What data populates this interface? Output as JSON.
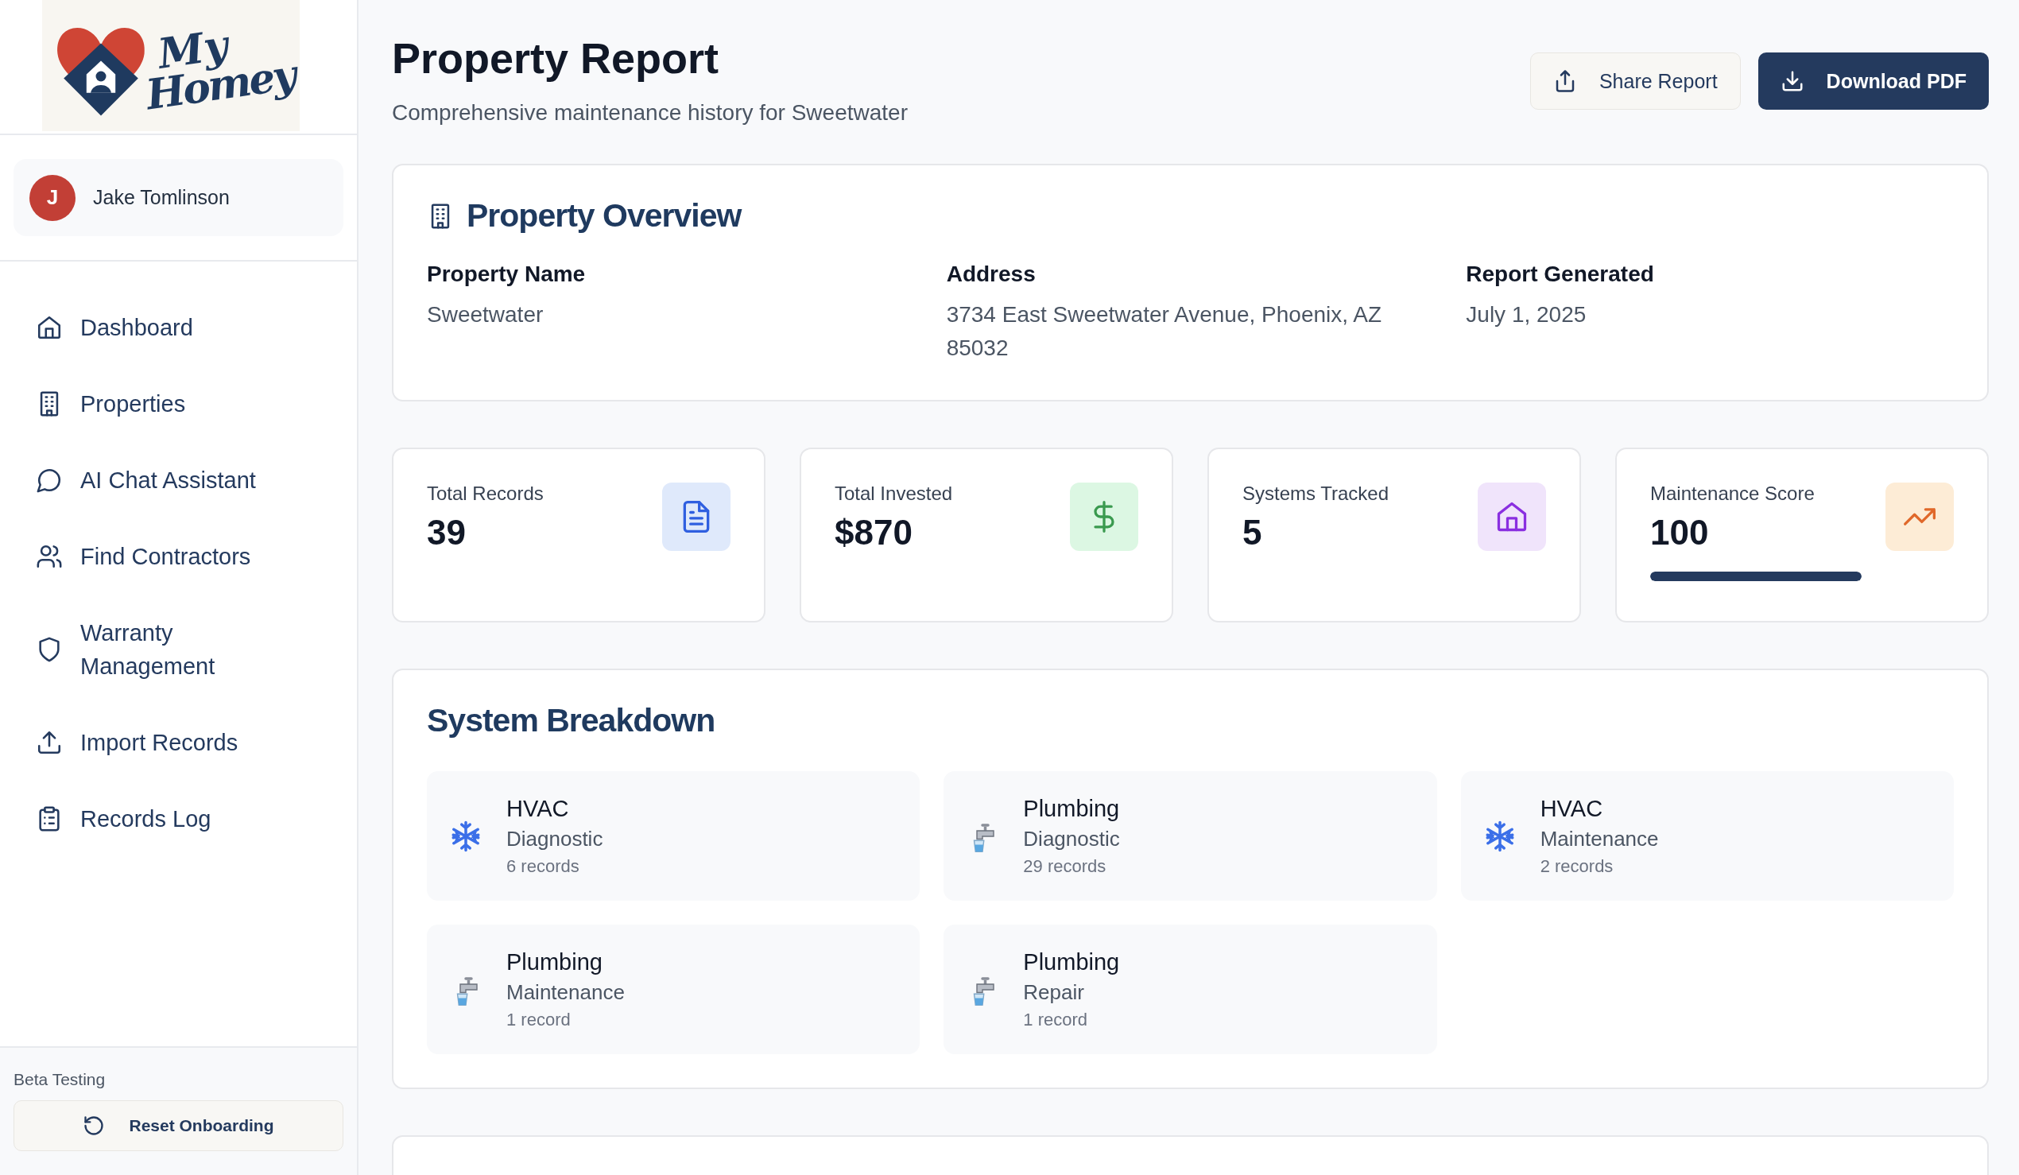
{
  "logo": {
    "line_1": "My",
    "line_2": "Homey"
  },
  "user": {
    "initial": "J",
    "name": "Jake Tomlinson"
  },
  "nav": [
    {
      "kind": "home",
      "label": "Dashboard",
      "selected": false
    },
    {
      "kind": "building",
      "label": "Properties",
      "selected": false
    },
    {
      "kind": "chat",
      "label": "AI Chat Assistant",
      "selected": false
    },
    {
      "kind": "users",
      "label": "Find Contractors",
      "selected": false
    },
    {
      "kind": "shield",
      "label": "Warranty Management",
      "selected": false
    },
    {
      "kind": "upload",
      "label": "Import Records",
      "selected": false
    },
    {
      "kind": "clipboard",
      "label": "Records Log",
      "selected": false
    }
  ],
  "beta": {
    "label": "Beta Testing",
    "button": "Reset Onboarding"
  },
  "header": {
    "title": "Property Report",
    "subtitle": "Comprehensive maintenance history for Sweetwater",
    "share_button": "Share Report",
    "download_button": "Download PDF"
  },
  "overview": {
    "title": "Property Overview",
    "fields": [
      {
        "label": "Property Name",
        "value": "Sweetwater"
      },
      {
        "label": "Address",
        "value": "3734 East Sweetwater Avenue, Phoenix, AZ 85032"
      },
      {
        "label": "Report Generated",
        "value": "July 1, 2025"
      }
    ]
  },
  "stats": [
    {
      "kind": "document",
      "label": "Total Records",
      "value": "39"
    },
    {
      "kind": "dollar",
      "label": "Total Invested",
      "value": "$870"
    },
    {
      "kind": "house",
      "label": "Systems Tracked",
      "value": "5"
    },
    {
      "kind": "trend",
      "label": "Maintenance Score",
      "value": "100",
      "level": 1.0
    }
  ],
  "breakdown": {
    "title": "System Breakdown",
    "items": [
      {
        "kind": "hvac",
        "system": "HVAC",
        "type": "Diagnostic",
        "count": "6 records"
      },
      {
        "kind": "plumbing",
        "system": "Plumbing",
        "type": "Diagnostic",
        "count": "29 records"
      },
      {
        "kind": "hvac",
        "system": "HVAC",
        "type": "Maintenance",
        "count": "2 records"
      },
      {
        "kind": "plumbing",
        "system": "Plumbing",
        "type": "Maintenance",
        "count": "1 record"
      },
      {
        "kind": "plumbing",
        "system": "Plumbing",
        "type": "Repair",
        "count": "1 record"
      }
    ]
  }
}
